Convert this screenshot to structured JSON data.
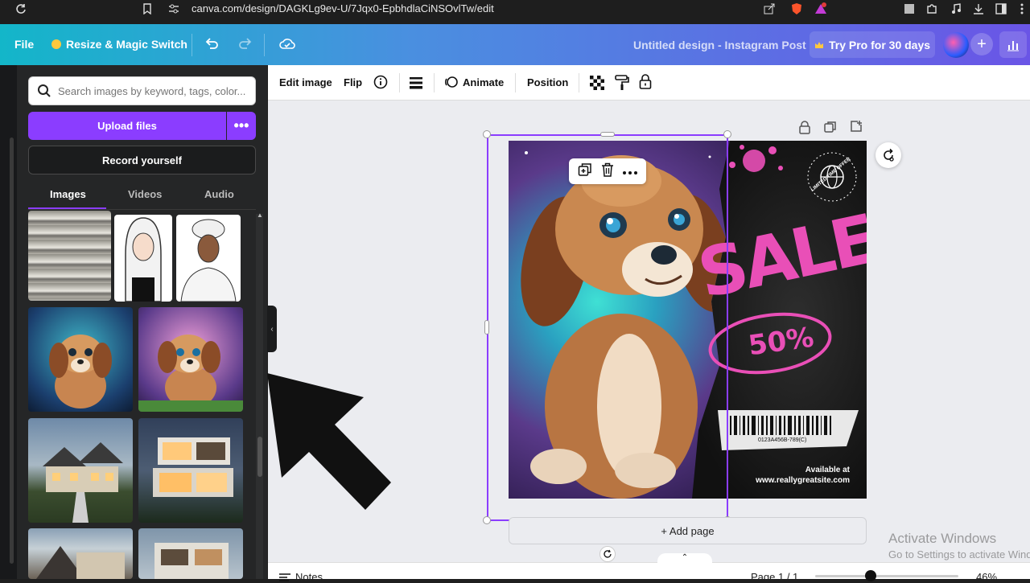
{
  "browser": {
    "url": "canva.com/design/DAGKLg9ev-U/7Jqx0-EpbhdlaCiNSOvlTw/edit"
  },
  "topbar": {
    "file_label": "File",
    "resize_label": "Resize & Magic Switch",
    "title": "Untitled design - Instagram Post",
    "try_pro_label": "Try Pro for 30 days",
    "plus_label": "+"
  },
  "sidepanel": {
    "search_placeholder": "Search images by keyword, tags, color...",
    "upload_label": "Upload files",
    "more_label": "•••",
    "record_label": "Record yourself",
    "tabs": [
      {
        "label": "Images",
        "active": true
      },
      {
        "label": "Videos",
        "active": false
      },
      {
        "label": "Audio",
        "active": false
      }
    ]
  },
  "contextbar": {
    "edit_image": "Edit image",
    "flip": "Flip",
    "animate": "Animate",
    "position": "Position"
  },
  "design": {
    "sale_text": "SALE",
    "discount": "50%",
    "badge_text": "LIMITED TIME OFFER",
    "barcode_number": "0123A456B-789(C)",
    "available_line1": "Available at",
    "available_line2": "www.reallygreatsite.com"
  },
  "canvas": {
    "add_page_label": "+ Add page"
  },
  "statusbar": {
    "notes_label": "Notes",
    "page_label": "Page 1 / 1",
    "zoom_label": "46%"
  },
  "watermark": {
    "line1": "Activate Windows",
    "line2": "Go to Settings to activate Windows."
  },
  "colors": {
    "brand_purple": "#8b3dff",
    "sale_pink": "#e94fb7",
    "topbar_start": "#13b6c9",
    "topbar_end": "#6a55e6"
  }
}
